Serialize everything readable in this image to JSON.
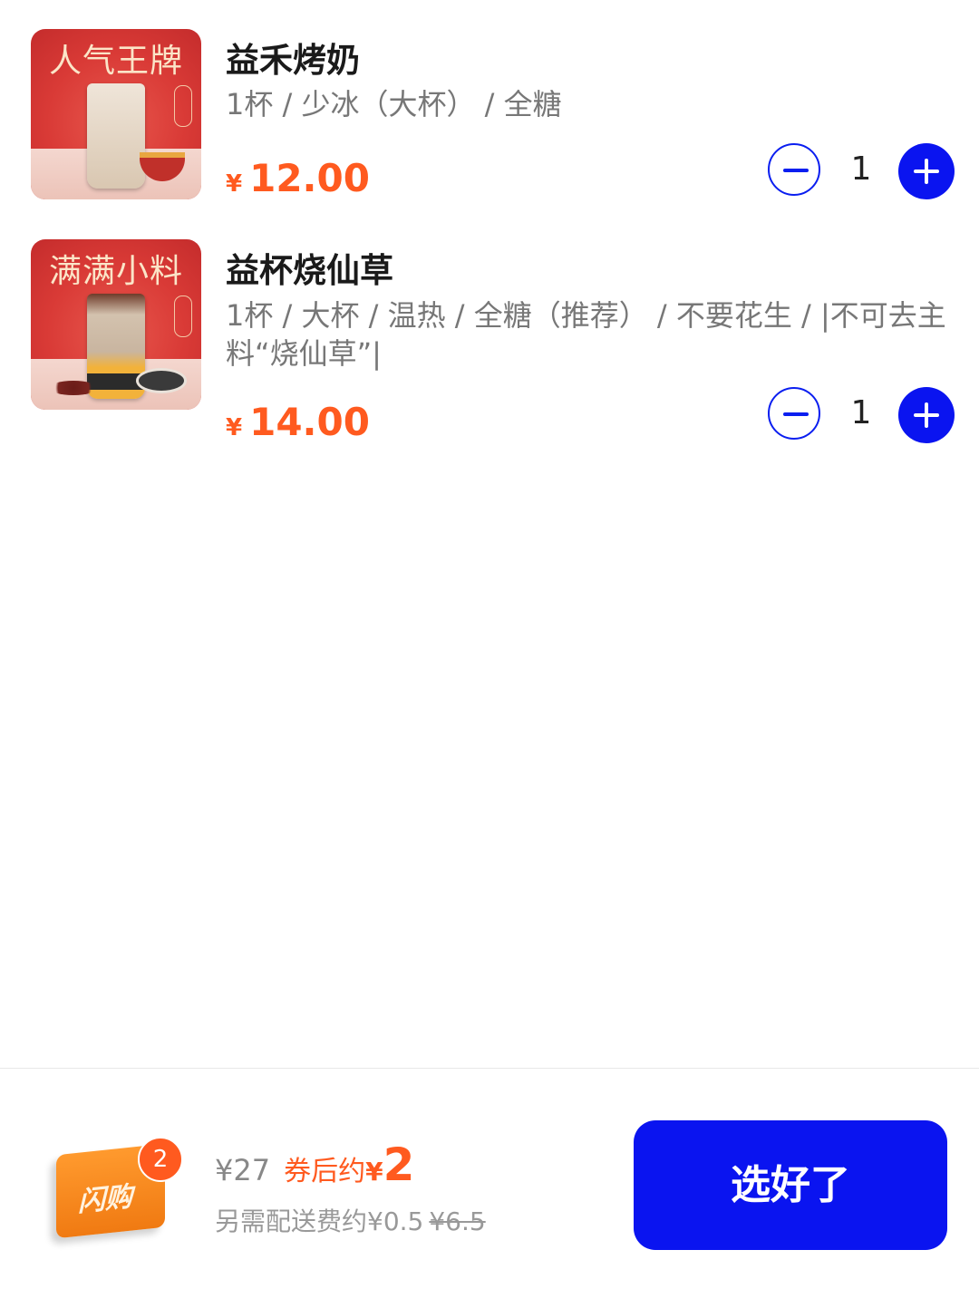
{
  "cart_items": [
    {
      "image_banner": "人气王牌",
      "title": "益禾烤奶",
      "spec": "1杯 / 少冰（大杯） / 全糖",
      "currency": "¥",
      "price": "12.00",
      "quantity": "1"
    },
    {
      "image_banner": "满满小料",
      "title": "益杯烧仙草",
      "spec": "1杯 / 大杯 / 温热 / 全糖（推荐） / 不要花生 / |不可去主料“烧仙草”|",
      "currency": "¥",
      "price": "14.00",
      "quantity": "1"
    }
  ],
  "footer": {
    "bag_label": "闪购",
    "bag_count": "2",
    "total": "¥27",
    "after_coupon_label": "券后约",
    "after_coupon_currency": "¥",
    "after_coupon_value": "2",
    "delivery_note": "另需配送费约¥0.5",
    "delivery_original": "¥6.5",
    "confirm_label": "选好了"
  },
  "colors": {
    "accent_blue": "#0a14f0",
    "price_orange": "#ff5a1f"
  }
}
